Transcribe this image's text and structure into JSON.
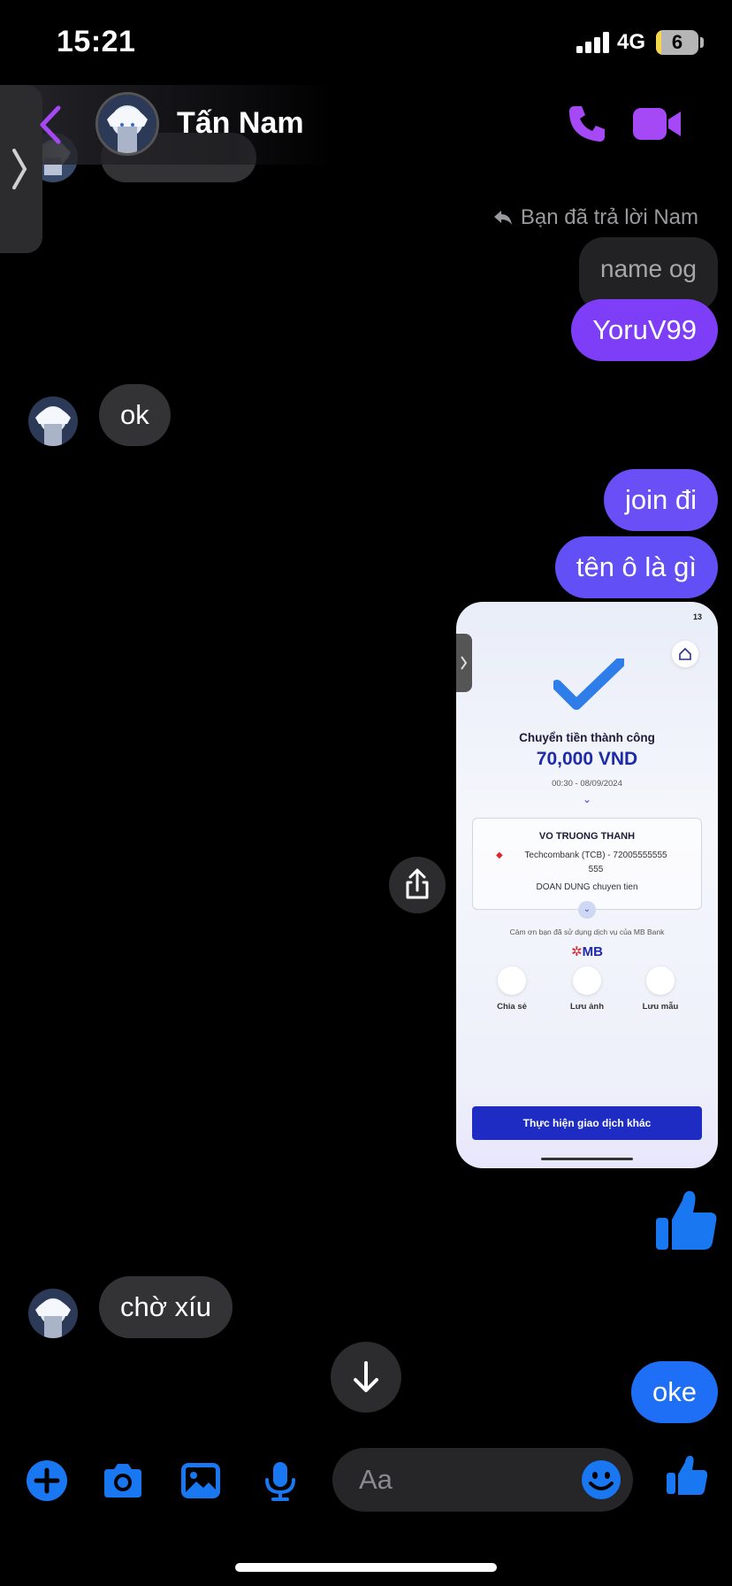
{
  "status_bar": {
    "time": "15:21",
    "network": "4G",
    "battery": "6"
  },
  "header": {
    "contact_name": "Tấn Nam"
  },
  "reply": {
    "indicator": "Bạn đã trả lời Nam",
    "quoted": "name og"
  },
  "messages": [
    {
      "text": "YoruV99",
      "from": "me"
    },
    {
      "text": "ok",
      "from": "them"
    },
    {
      "text": "join đi",
      "from": "me"
    },
    {
      "text": "tên ô là gì",
      "from": "me"
    },
    {
      "text": "chờ xíu",
      "from": "them"
    },
    {
      "text": "oke",
      "from": "me"
    }
  ],
  "screenshot": {
    "status": "13",
    "title": "Chuyển tiền thành công",
    "amount": "70,000 VND",
    "datetime": "00:30 - 08/09/2024",
    "recipient": "VO TRUONG THANH",
    "bank": "Techcombank (TCB) - 72005555555",
    "bank_cont": "555",
    "note": "DOAN DUNG chuyen tien",
    "thanks": "Cảm ơn bạn đã sử dụng dịch vụ của MB Bank",
    "brand": "MB",
    "actions": [
      "Chia sẻ",
      "Lưu ảnh",
      "Lưu mẫu"
    ],
    "button": "Thực hiện giao dịch khác"
  },
  "composer": {
    "placeholder": "Aa"
  },
  "colors": {
    "outgoing": "#7e3ef7",
    "outgoing_blue": "#1e6ff5",
    "incoming": "#333335",
    "accent": "#a548f5",
    "blue": "#1a77f2"
  }
}
